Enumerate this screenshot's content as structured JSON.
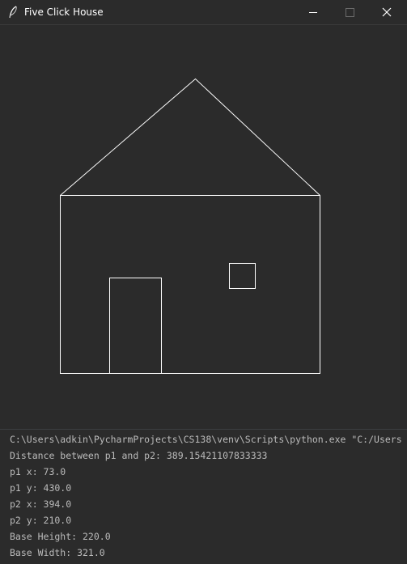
{
  "window": {
    "title": "Five Click House",
    "icon": "feather-icon"
  },
  "titlebar_buttons": {
    "minimize": "minimize-icon",
    "maximize": "maximize-icon",
    "close": "close-icon"
  },
  "colors": {
    "background": "#2b2b2b",
    "stroke": "#ffffff",
    "console_text": "#bbbbbb"
  },
  "console": {
    "lines": [
      "C:\\Users\\adkin\\PycharmProjects\\CS138\\venv\\Scripts\\python.exe \"C:/Users",
      "Distance between p1 and p2: 389.15421107833333",
      "p1 x: 73.0",
      "p1 y: 430.0",
      "p2 x: 394.0",
      "p2 y: 210.0",
      "Base Height: 220.0",
      "Base Width: 321.0"
    ]
  }
}
